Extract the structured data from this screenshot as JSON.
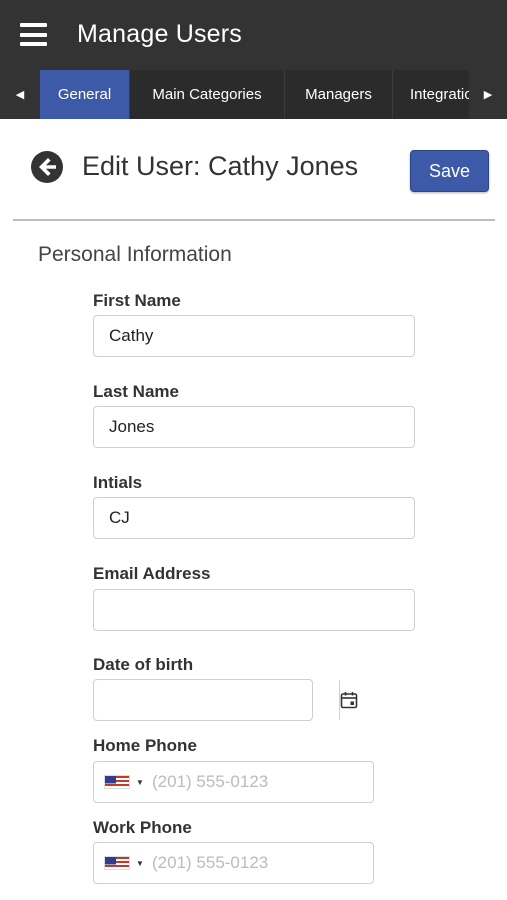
{
  "app": {
    "title": "Manage Users"
  },
  "tabs": [
    {
      "label": "General",
      "active": true
    },
    {
      "label": "Main Categories",
      "active": false
    },
    {
      "label": "Managers",
      "active": false
    },
    {
      "label": "Integrations",
      "active": false
    }
  ],
  "icons": {
    "menu": "hamburger-menu-icon",
    "tab_left": "triangle-left-icon",
    "tab_right": "triangle-right-icon",
    "back": "circle-arrow-left-icon",
    "calendar": "calendar-icon",
    "flag": "us-flag-icon",
    "caret": "caret-down-icon"
  },
  "colors": {
    "appbar": "#333333",
    "accent": "#3d5aa8"
  },
  "page": {
    "title": "Edit User: Cathy Jones",
    "save_label": "Save"
  },
  "section": {
    "title": "Personal Information"
  },
  "fields": {
    "first_name": {
      "label": "First Name",
      "value": "Cathy"
    },
    "last_name": {
      "label": "Last Name",
      "value": "Jones"
    },
    "initials": {
      "label": "Intials",
      "value": "CJ"
    },
    "email": {
      "label": "Email Address",
      "value": ""
    },
    "dob": {
      "label": "Date of birth",
      "value": ""
    },
    "home_phone": {
      "label": "Home Phone",
      "value": "",
      "placeholder": "(201) 555-0123"
    },
    "work_phone": {
      "label": "Work Phone",
      "value": "",
      "placeholder": "(201) 555-0123"
    }
  }
}
